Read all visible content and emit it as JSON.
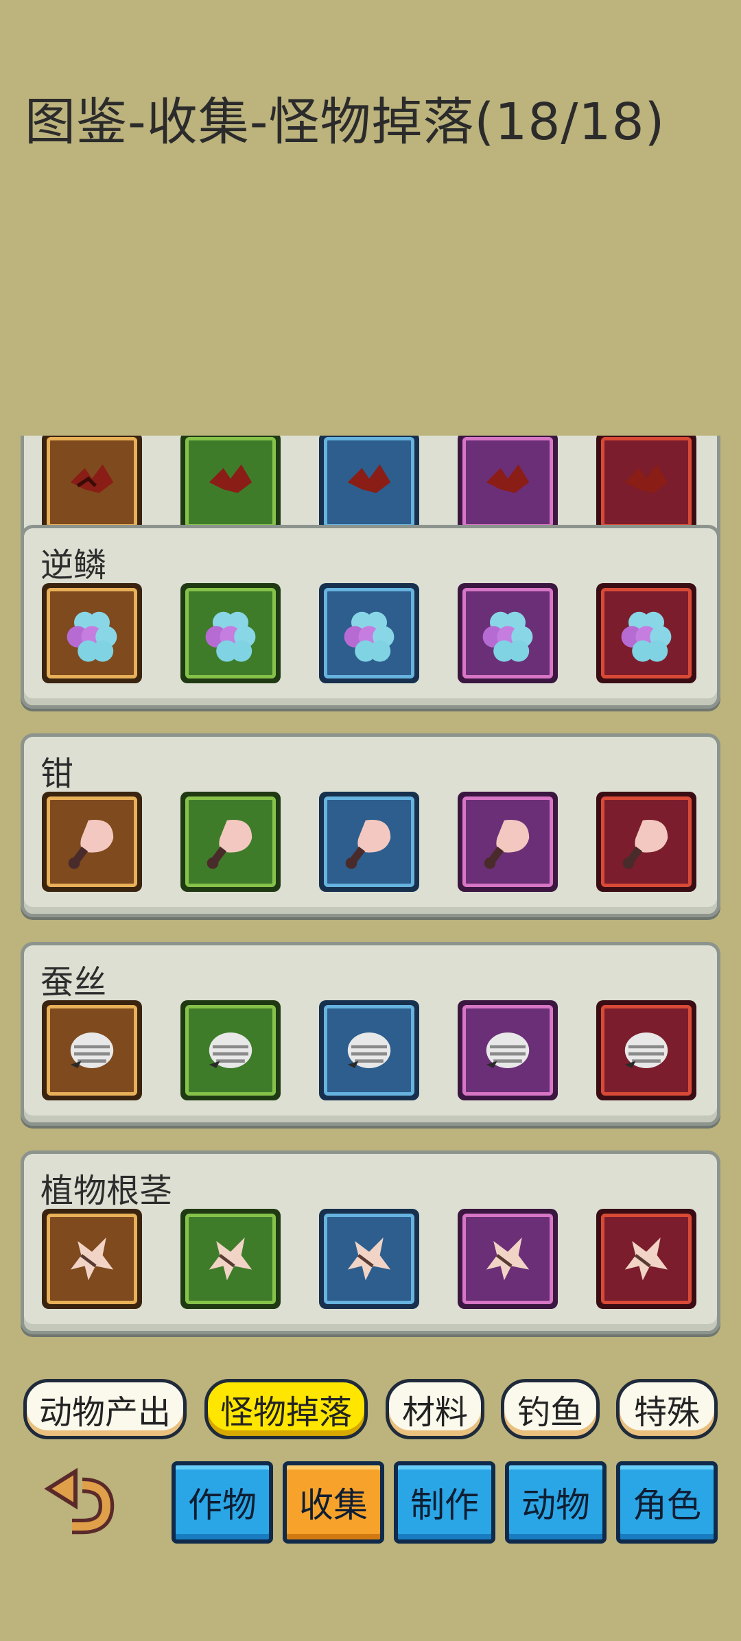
{
  "header": {
    "title": "图鉴-收集-怪物掉落(18/18)"
  },
  "collection": {
    "tiers": [
      "bronze",
      "green",
      "blue",
      "purple",
      "red"
    ],
    "tier_colors": [
      "#7e4a1e",
      "#3f7c2a",
      "#2d5e8e",
      "#6b2f77",
      "#7b1d2c"
    ],
    "rows": [
      {
        "label": "",
        "icon": "monster-drop-icon"
      },
      {
        "label": "逆鳞",
        "icon": "reverse-scale-icon"
      },
      {
        "label": "钳",
        "icon": "claw-icon"
      },
      {
        "label": "蚕丝",
        "icon": "silk-icon"
      },
      {
        "label": "植物根茎",
        "icon": "root-icon"
      }
    ]
  },
  "subtabs": {
    "items": [
      {
        "label": "动物产出"
      },
      {
        "label": "怪物掉落"
      },
      {
        "label": "材料"
      },
      {
        "label": "钓鱼"
      },
      {
        "label": "特殊"
      }
    ],
    "active": "怪物掉落"
  },
  "nav": {
    "back_icon": "back-arrow-icon",
    "items": [
      {
        "label": "作物"
      },
      {
        "label": "收集"
      },
      {
        "label": "制作"
      },
      {
        "label": "动物"
      },
      {
        "label": "角色"
      }
    ],
    "active": "收集"
  }
}
